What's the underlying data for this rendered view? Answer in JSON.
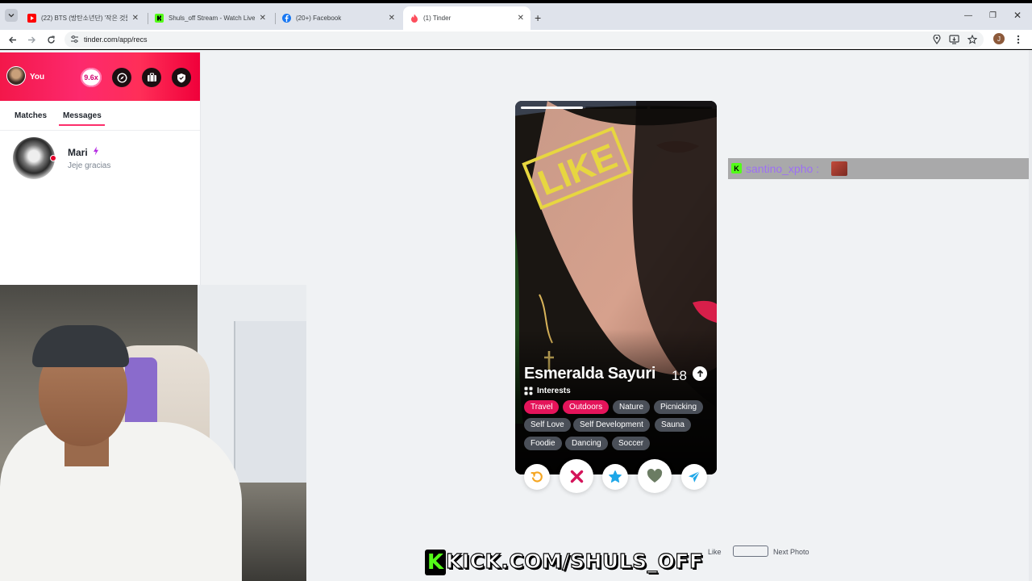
{
  "browser": {
    "tabs": [
      {
        "title": "(22) BTS (방탄소년단) '작은 것들",
        "favicon": "youtube-icon",
        "active": false
      },
      {
        "title": "Shuls_off Stream - Watch Live o",
        "favicon": "kick-icon",
        "active": false
      },
      {
        "title": "(20+) Facebook",
        "favicon": "facebook-icon",
        "active": false
      },
      {
        "title": "(1) Tinder",
        "favicon": "tinder-icon",
        "active": true
      }
    ],
    "url": "tinder.com/app/recs",
    "profile_initial": "J"
  },
  "sidebar": {
    "user_label": "You",
    "multiplier": "9.6x",
    "tabs": [
      {
        "label": "Matches",
        "active": false
      },
      {
        "label": "Messages",
        "active": true
      }
    ],
    "messages": [
      {
        "name": "Mari",
        "preview": "Jeje gracias",
        "online": true
      }
    ]
  },
  "profile": {
    "name": "Esmeralda Sayuri",
    "age": "18",
    "photo_count": 3,
    "current_photo": 1,
    "interests_label": "Interests",
    "interests": [
      {
        "label": "Travel",
        "shared": true
      },
      {
        "label": "Outdoors",
        "shared": true
      },
      {
        "label": "Nature",
        "shared": false
      },
      {
        "label": "Picnicking",
        "shared": false
      },
      {
        "label": "Self Love",
        "shared": false
      },
      {
        "label": "Self Development",
        "shared": false
      },
      {
        "label": "Sauna",
        "shared": false
      },
      {
        "label": "Foodie",
        "shared": false
      },
      {
        "label": "Dancing",
        "shared": false
      },
      {
        "label": "Soccer",
        "shared": false
      }
    ],
    "stamp": "LIKE"
  },
  "actions": [
    {
      "name": "rewind-button",
      "icon": "rewind-icon",
      "color": "#f5a623"
    },
    {
      "name": "nope-button",
      "icon": "x-icon",
      "color": "#d4145a"
    },
    {
      "name": "super-like-button",
      "icon": "star-icon",
      "color": "#1ea7e8"
    },
    {
      "name": "like-button",
      "icon": "heart-icon",
      "color": "#6b7c63"
    },
    {
      "name": "boost-button",
      "icon": "send-icon",
      "color": "#1ea7e8"
    }
  ],
  "hints": {
    "like": "Like",
    "next_photo": "Next Photo"
  },
  "stream_overlay": {
    "chat_user": "santino_xpho :",
    "watermark": "KICK.COM/SHULS_OFF",
    "kick_color": "#53fc18"
  }
}
